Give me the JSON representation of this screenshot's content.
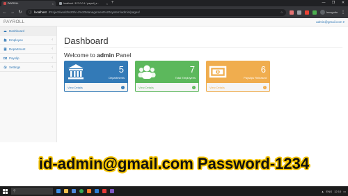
{
  "browser": {
    "tabs": [
      {
        "title": "PAYROLL",
        "active": true
      },
      {
        "title": "localhost / 127.0.0.1 / payroll_s...",
        "active": false
      }
    ],
    "new_tab": "+",
    "url_host": "localhost",
    "url_path": "/Project/world%20hr-d%20Management%20system/admin/pages/",
    "profile_label": "Incognito",
    "window_controls": {
      "minimize": "—",
      "maximize": "❐",
      "close": "✕"
    }
  },
  "app": {
    "brand": "PAYROLL",
    "user_email": "admin@gmail.com ▾"
  },
  "sidebar": {
    "items": [
      {
        "label": "Dashboard",
        "icon": "dashboard-icon",
        "has_submenu": false
      },
      {
        "label": "Employee",
        "icon": "users-icon",
        "has_submenu": true
      },
      {
        "label": "Department",
        "icon": "building-icon",
        "has_submenu": true
      },
      {
        "label": "Payslip",
        "icon": "money-icon",
        "has_submenu": true
      },
      {
        "label": "Settings",
        "icon": "gear-icon",
        "has_submenu": true
      }
    ]
  },
  "main": {
    "title": "Dashboard",
    "welcome_prefix": "Welcome to",
    "welcome_bold": "admin",
    "welcome_suffix": "Panel",
    "cards": [
      {
        "count": "5",
        "label": "Departments",
        "footer": "View Details",
        "color": "#337ab7",
        "icon": "bank-icon"
      },
      {
        "count": "7",
        "label": "Total Employees",
        "footer": "View Details",
        "color": "#5cb85c",
        "icon": "users-icon"
      },
      {
        "count": "6",
        "label": "Payslips Released",
        "footer": "View Details",
        "color": "#f0ad4e",
        "icon": "money-icon"
      }
    ]
  },
  "caption": "id-admin@gmail.com Password-1234",
  "taskbar": {
    "search_placeholder": "",
    "tray_lang": "ENG",
    "tray_time": "12:10"
  }
}
